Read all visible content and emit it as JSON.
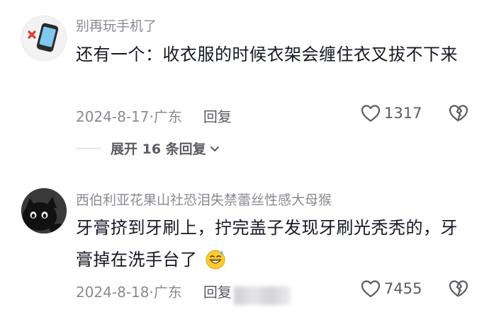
{
  "comments": [
    {
      "username": "别再玩手机了",
      "content": "还有一个：收衣服的时候衣架会缠住衣叉拔不下来",
      "date": "2024-8-17",
      "location": "广东",
      "reply_label": "回复",
      "likes": "1317",
      "expand_label": "展开 16 条回复",
      "avatar_icon": "phone-no-icon"
    },
    {
      "username": "西伯利亚花果山社恐泪失禁蕾丝性感大母猴",
      "content": "牙膏挤到牙刷上，拧完盖子发现牙刷光秃秃的，牙膏掉在洗手台了",
      "emoji": "grinning-sweat-emoji",
      "date": "2024-8-18",
      "location": "广东",
      "reply_label": "回复",
      "likes": "7455",
      "avatar_icon": "black-cat-avatar"
    }
  ],
  "colors": {
    "text_primary": "#161823",
    "text_secondary": "#8a8b91",
    "accent_dark": "#5b5c62"
  }
}
